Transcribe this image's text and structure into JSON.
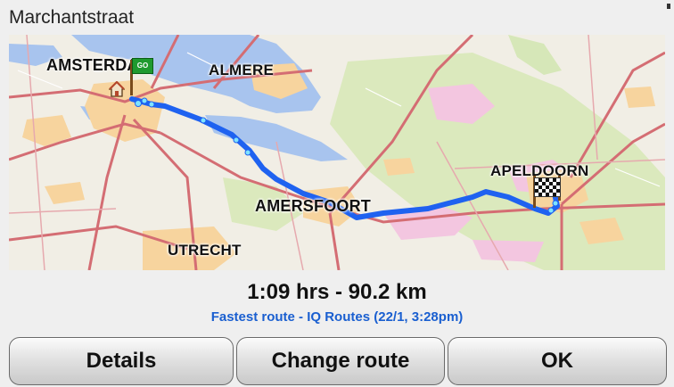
{
  "header": {
    "title": "Marchantstraat"
  },
  "map": {
    "cities": {
      "amsterdam": "AMSTERDAM",
      "almere": "ALMERE",
      "amersfoort": "AMERSFOORT",
      "apeldoorn": "APELDOORN",
      "utrecht": "UTRECHT"
    },
    "start_flag_label": "GO",
    "route_color": "#1f62f0"
  },
  "route": {
    "summary": "1:09 hrs - 90.2 km",
    "detail": "Fastest route - IQ Routes (22/1,  3:28pm)"
  },
  "buttons": {
    "details": "Details",
    "change_route": "Change route",
    "ok": "OK"
  },
  "colors": {
    "water": "#a8c4ee",
    "urban": "#f7d49e",
    "forest": "#d6e7b8",
    "roads": "#d46d73",
    "link": "#1a5fd0"
  }
}
